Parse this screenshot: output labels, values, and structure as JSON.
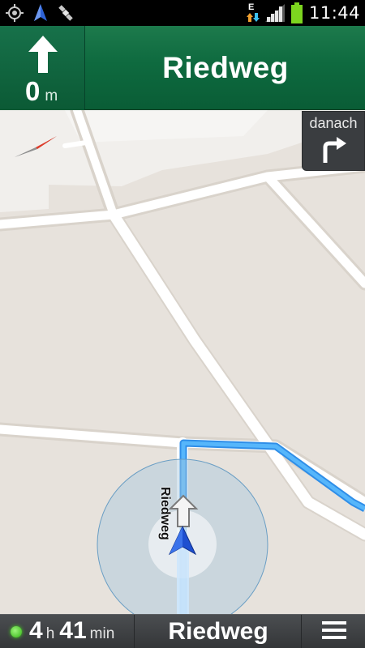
{
  "status_bar": {
    "clock": "11:44",
    "edge_indicator": "E",
    "left_icons": [
      "gps-target-icon",
      "navigation-arrow-icon",
      "satellite-icon"
    ],
    "right_icons": [
      "edge-data-icon",
      "signal-strength-icon",
      "battery-icon"
    ]
  },
  "header": {
    "maneuver_icon": "straight-arrow-icon",
    "distance_value": "0",
    "distance_unit": "m",
    "street": "Riedweg"
  },
  "next_turn": {
    "label": "danach",
    "icon": "turn-right-arrow-icon"
  },
  "map": {
    "road_label": "Riedweg",
    "compass_icon": "compass-icon",
    "position_icon": "current-position-arrow-icon",
    "colors": {
      "background": "#e7e2dc",
      "road": "#ffffff",
      "route": "#3ea6f7"
    }
  },
  "bottom_bar": {
    "gps_status_icon": "gps-status-dot-icon",
    "hours_value": "4",
    "hours_unit": "h",
    "minutes_value": "41",
    "minutes_unit": "min",
    "street": "Riedweg",
    "menu_icon": "menu-icon"
  }
}
